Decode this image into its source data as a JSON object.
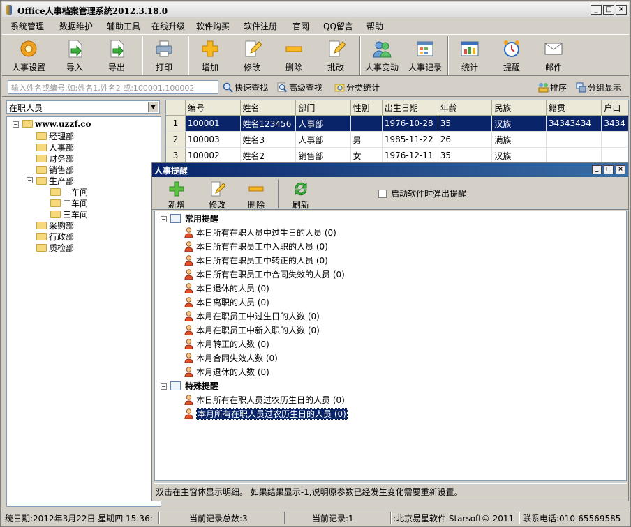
{
  "window": {
    "title": "Office人事档案管理系统2012.3.18.0"
  },
  "menu": [
    "系统管理",
    "数据维护",
    "辅助工具",
    "在线升级",
    "软件购买",
    "软件注册",
    "官网",
    "QQ留言",
    "帮助"
  ],
  "toolbar": [
    "人事设置",
    "导入",
    "导出",
    "打印",
    "增加",
    "修改",
    "删除",
    "批改",
    "人事变动",
    "人事记录",
    "统计",
    "提醒",
    "邮件"
  ],
  "search": {
    "placeholder": "输入姓名或编号,如:姓名1,姓名2 或:100001,100002",
    "quick": "快速查找",
    "advanced": "高级查找",
    "classify": "分类统计",
    "sort": "排序",
    "group": "分组显示"
  },
  "filter": {
    "selected": "在职人员"
  },
  "tree": {
    "root": "www.uzzf.co",
    "departments": [
      "经理部",
      "人事部",
      "财务部",
      "销售部",
      "生产部",
      "一车间",
      "二车间",
      "三车间",
      "采购部",
      "行政部",
      "质检部"
    ]
  },
  "grid": {
    "columns": [
      "编号",
      "姓名",
      "部门",
      "性别",
      "出生日期",
      "年龄",
      "民族",
      "籍贯",
      "户口"
    ],
    "rows": [
      {
        "n": "1",
        "cells": [
          "100001",
          "姓名123456",
          "人事部",
          "",
          "1976-10-28",
          "35",
          "汉族",
          "34343434",
          "3434"
        ]
      },
      {
        "n": "2",
        "cells": [
          "100003",
          "姓名3",
          "人事部",
          "男",
          "1985-11-22",
          "26",
          "满族",
          "",
          ""
        ]
      },
      {
        "n": "3",
        "cells": [
          "100002",
          "姓名2",
          "销售部",
          "女",
          "1976-12-11",
          "35",
          "汉族",
          "",
          ""
        ]
      }
    ]
  },
  "dialog": {
    "title": "人事提醒",
    "toolbar": [
      "新增",
      "修改",
      "删除",
      "刷新"
    ],
    "popup_checkbox": "启动软件时弹出提醒",
    "group1": "常用提醒",
    "group1_items": [
      "本日所有在职人员中过生日的人员 (0)",
      "本日所有在职员工中入职的人员 (0)",
      "本日所有在职员工中转正的人员 (0)",
      "本日所有在职员工中合同失效的人员 (0)",
      "本日退休的人员 (0)",
      "本日离职的人员 (0)",
      "本月在职员工中过生日的人数 (0)",
      "本月在职员工中新入职的人数 (0)",
      "本月转正的人数 (0)",
      "本月合同失效人数 (0)",
      "本月退休的人数 (0)"
    ],
    "group2": "特殊提醒",
    "group2_items": [
      "本日所有在职人员过农历生日的人员 (0)",
      "本月所有在职人员过农历生日的人员 (0)"
    ],
    "status": "双击在主窗体显示明细。  如果结果显示-1,说明原参数已经发生变化需要重新设置。"
  },
  "statusbar": {
    "date": "统日期:2012年3月22日 星期四  15:36:",
    "total": "当前记录总数:3",
    "current": "当前记录:1",
    "company": ":北京易星软件 Starsoft© 2011",
    "phone": "联系电话:010-65569585"
  }
}
